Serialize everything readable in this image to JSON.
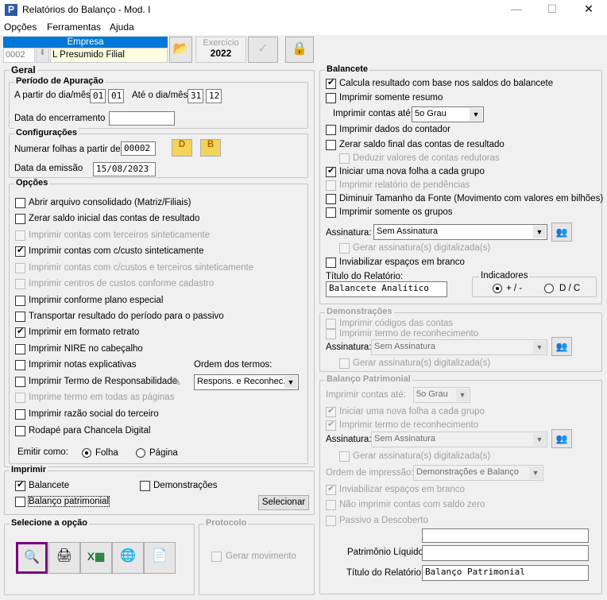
{
  "window": {
    "title": "Relatórios do Balanço - Mod. I",
    "minimize": "—",
    "maximize": "☐",
    "close": "✕"
  },
  "menu": [
    "Opções",
    "Ferramentas",
    "Ajuda"
  ],
  "empresa": {
    "header": "Empresa",
    "code": "0002",
    "name": "L Presumido Filial"
  },
  "exercicio": {
    "label": "Exercício",
    "value": "2022"
  },
  "geral": {
    "title": "Geral",
    "periodo": {
      "title": "Período de Apuração",
      "from_label": "A partir do dia/mês",
      "from_day": "01",
      "from_month": "01",
      "to_label": "Até o dia/mês",
      "to_day": "31",
      "to_month": "12",
      "encerramento_label": "Data do encerramento",
      "encerramento": ""
    },
    "config": {
      "title": "Configurações",
      "numerar_label": "Numerar folhas a partir de",
      "numerar": "00002",
      "btn_d": "D",
      "btn_b": "B",
      "emissao_label": "Data da emissão",
      "emissao": "15/08/2023"
    },
    "opcoes": {
      "title": "Opções",
      "items": [
        {
          "label": "Abrir arquivo consolidado (Matriz/Filiais)",
          "checked": false,
          "disabled": false
        },
        {
          "label": "Zerar saldo inicial das contas de resultado",
          "checked": false,
          "disabled": false
        },
        {
          "label": "Imprimir contas com terceiros sinteticamente",
          "checked": false,
          "disabled": true
        },
        {
          "label": "Imprimir contas com c/custo sinteticamente",
          "checked": true,
          "disabled": false
        },
        {
          "label": "Imprimir contas com c/custos e terceiros sinteticamente",
          "checked": false,
          "disabled": true
        },
        {
          "label": "Imprimir centros de custos conforme cadastro",
          "checked": false,
          "disabled": true
        },
        {
          "label": "Imprimir conforme plano especial",
          "checked": false,
          "disabled": false
        },
        {
          "label": "Transportar resultado do período para o passivo",
          "checked": false,
          "disabled": false
        },
        {
          "label": "Imprimir em formato retrato",
          "checked": true,
          "disabled": false
        },
        {
          "label": "Imprimir NIRE no cabeçalho",
          "checked": false,
          "disabled": false
        },
        {
          "label": "Imprimir notas explicativas",
          "checked": false,
          "disabled": false
        },
        {
          "label": "Imprimir Termo de Responsabilidade",
          "checked": false,
          "disabled": false
        },
        {
          "label": "Imprime termo em todas as páginas",
          "checked": false,
          "disabled": true
        },
        {
          "label": "Imprimir razão social do terceiro",
          "checked": false,
          "disabled": false
        },
        {
          "label": "Rodapé para Chancela Digital",
          "checked": false,
          "disabled": false
        }
      ],
      "ordem_label": "Ordem dos termos:",
      "ordem_value": "Respons. e Reconhec.",
      "emitir_label": "Emitir como:",
      "emitir_folha": "Folha",
      "emitir_pagina": "Página"
    }
  },
  "imprimir": {
    "title": "Imprimir",
    "balancete": "Balancete",
    "demonstracoes": "Demonstrações",
    "balanco": "Balanço patrimonial",
    "selecionar": "Selecionar"
  },
  "selecione": {
    "title": "Selecione a opção"
  },
  "protocolo": {
    "title": "Protocolo",
    "gerar": "Gerar movimento"
  },
  "balancete": {
    "title": "Balancete",
    "items": [
      {
        "label": "Calcula resultado com base nos saldos do balancete",
        "checked": true,
        "disabled": false
      },
      {
        "label": "Imprimir somente resumo",
        "checked": false,
        "disabled": false
      },
      {
        "label": "Imprimir dados do contador",
        "checked": false,
        "disabled": false
      },
      {
        "label": "Zerar saldo final das contas de resultado",
        "checked": false,
        "disabled": false
      },
      {
        "label": "Deduzir valores de contas redutoras",
        "checked": false,
        "disabled": true
      },
      {
        "label": "Iniciar uma nova folha a cada grupo",
        "checked": true,
        "disabled": false
      },
      {
        "label": "Imprimir relatório de pendências",
        "checked": false,
        "disabled": true
      },
      {
        "label": "Diminuir Tamanho da Fonte (Movimento com valores em bilhões)",
        "checked": false,
        "disabled": false
      },
      {
        "label": "Imprimir somente os grupos",
        "checked": false,
        "disabled": false
      },
      {
        "label": "Gerar assinatura(s) digitalizada(s)",
        "checked": false,
        "disabled": true
      },
      {
        "label": "Inviabilizar espaços em branco",
        "checked": false,
        "disabled": false
      }
    ],
    "contas_label": "Imprimir contas até:",
    "contas_value": "5o Grau",
    "assinatura_label": "Assinatura:",
    "assinatura_value": "Sem Assinatura",
    "titulo_label": "Título do Relatório:",
    "titulo": "Balancete Analítico",
    "indicadores": {
      "title": "Indicadores",
      "opt1": "+ / -",
      "opt2": "D / C"
    }
  },
  "demonstracoes": {
    "title": "Demonstrações",
    "items": [
      {
        "label": "Imprimir códigos das contas",
        "checked": false,
        "disabled": true
      },
      {
        "label": "Imprimir termo de reconhecimento",
        "checked": false,
        "disabled": true
      },
      {
        "label": "Gerar assinatura(s) digitalizada(s)",
        "checked": false,
        "disabled": true
      }
    ],
    "assinatura_label": "Assinatura:",
    "assinatura_value": "Sem Assinatura"
  },
  "balanco": {
    "title": "Balanço Patrimonial",
    "contas_label": "Imprimir contas até:",
    "contas_value": "5o Grau",
    "items": [
      {
        "label": "Iniciar uma nova folha a cada grupo",
        "checked": true,
        "disabled": true
      },
      {
        "label": "Imprimir termo de reconhecimento",
        "checked": true,
        "disabled": true
      },
      {
        "label": "Gerar assinatura(s) digitalizada(s)",
        "checked": false,
        "disabled": true
      },
      {
        "label": "Inviabilizar espaços em branco",
        "checked": true,
        "disabled": true
      },
      {
        "label": "Não imprimir contas com saldo zero",
        "checked": false,
        "disabled": true
      },
      {
        "label": "Passivo a Descoberto",
        "checked": false,
        "disabled": true
      }
    ],
    "assinatura_label": "Assinatura:",
    "assinatura_value": "Sem Assinatura",
    "ordem_label": "Ordem de impressão:",
    "ordem_value": "Demonstrações e Balanço",
    "pl_label": "Patrimônio Líquido",
    "pl": "",
    "titulo_label": "Título do Relatório:",
    "titulo": "Balanço Patrimonial",
    "blank": ""
  }
}
